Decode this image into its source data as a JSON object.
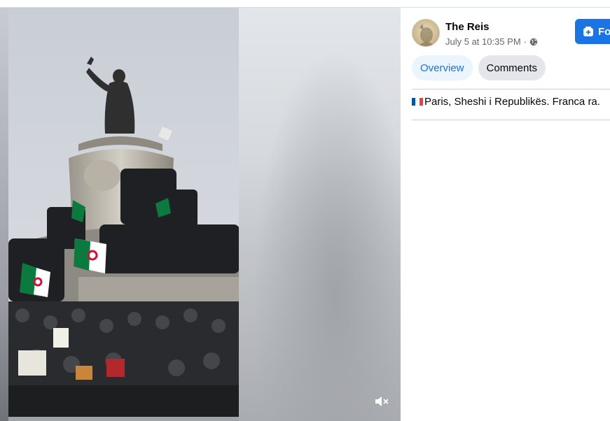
{
  "post": {
    "author": "The Reis",
    "timestamp": "July 5 at 10:35 PM",
    "separator": "·",
    "audience_icon": "globe-icon",
    "caption": "Paris, Sheshi i Republikës. Franca ra.",
    "caption_flag": "flag-france-icon"
  },
  "follow_button": {
    "label": "Fo",
    "icon": "follow-page-icon",
    "color": "#1b74e4"
  },
  "tabs": [
    {
      "label": "Overview",
      "active": true
    },
    {
      "label": "Comments",
      "active": false
    }
  ],
  "video": {
    "mute_icon": "speaker-muted-icon"
  },
  "colors": {
    "accent": "#1b74e4",
    "tab_active_bg": "#ebf5ff",
    "tab_inactive_bg": "#e4e6eb",
    "meta_text": "#65676b"
  }
}
